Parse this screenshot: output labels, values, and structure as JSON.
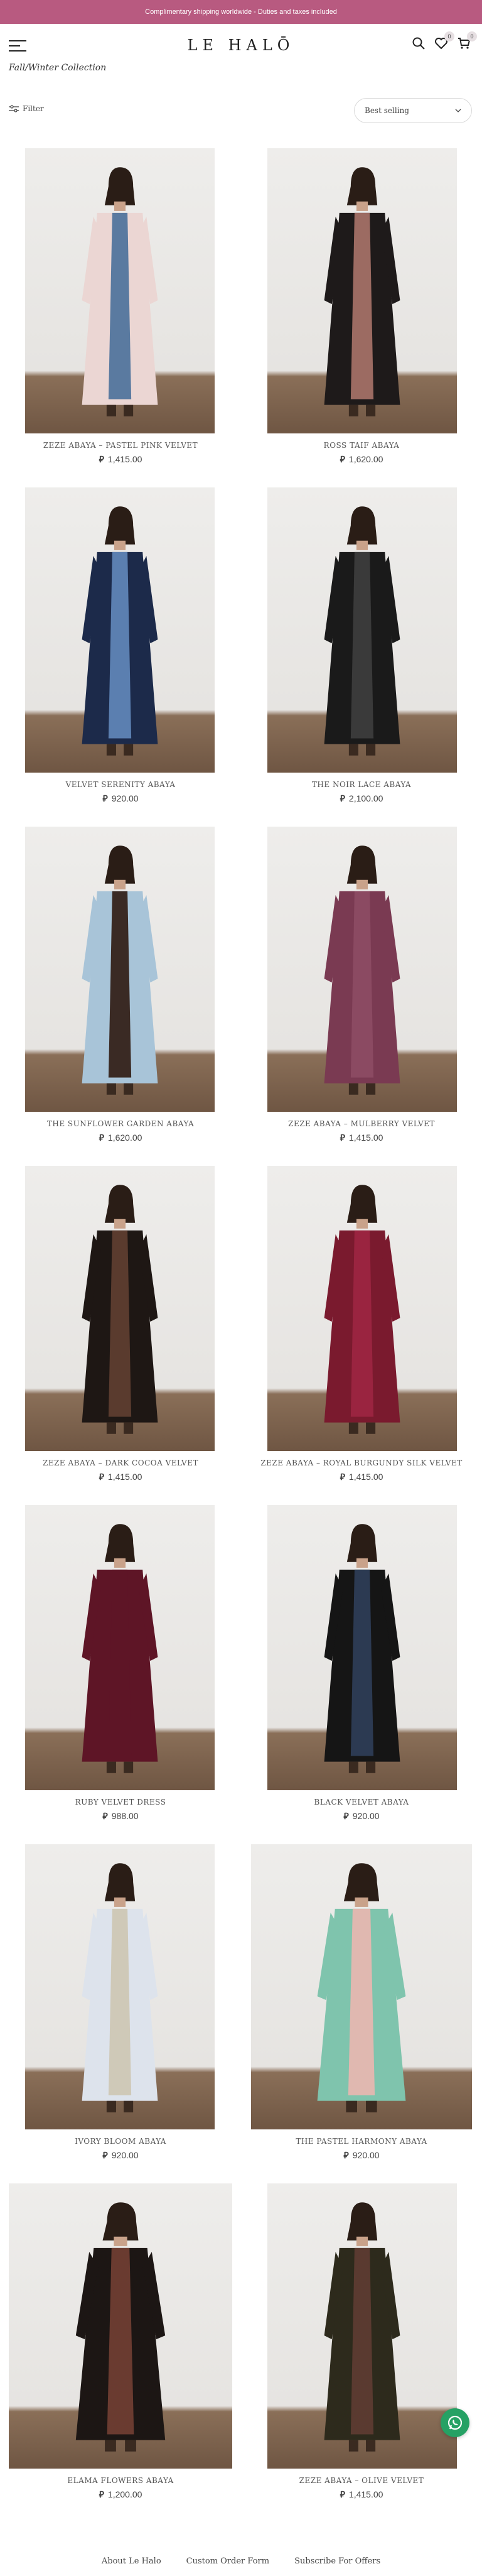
{
  "promo": {
    "text": "Complimentary shipping worldwide - Duties and taxes included"
  },
  "header": {
    "logo": "LE HALŌ",
    "wishlist_count": "0",
    "cart_count": "0"
  },
  "collection": {
    "title": "Fall/Winter Collection"
  },
  "toolbar": {
    "filter_label": "Filter",
    "sort_value": "Best selling"
  },
  "currency_symbol": "⃁",
  "products": [
    {
      "name": "ZEZE ABAYA – PASTEL PINK VELVET",
      "price": "1,415.00",
      "robe": "#ebd6d3",
      "inner": "#5a7aa0"
    },
    {
      "name": "ROSS TAIF ABAYA",
      "price": "1,620.00",
      "robe": "#1e1a1a",
      "inner": "#9c6b62"
    },
    {
      "name": "VELVET SERENITY ABAYA",
      "price": "920.00",
      "robe": "#1c2a4a",
      "inner": "#5b7fb0"
    },
    {
      "name": "THE NOIR LACE ABAYA",
      "price": "2,100.00",
      "robe": "#1a1a1a",
      "inner": "#3a3a3a"
    },
    {
      "name": "THE SUNFLOWER GARDEN ABAYA",
      "price": "1,620.00",
      "robe": "#a8c4d8",
      "inner": "#3a2a24"
    },
    {
      "name": "ZEZE ABAYA – MULBERRY VELVET",
      "price": "1,415.00",
      "robe": "#7a3a52",
      "inner": "#8b4a62"
    },
    {
      "name": "ZEZE ABAYA – DARK COCOA VELVET",
      "price": "1,415.00",
      "robe": "#1e1714",
      "inner": "#5a3b2e"
    },
    {
      "name": "ZEZE ABAYA – ROYAL BURGUNDY SILK VELVET",
      "price": "1,415.00",
      "robe": "#7a1a2e",
      "inner": "#9a2440"
    },
    {
      "name": "RUBY VELVET DRESS",
      "price": "988.00",
      "robe": "#5e1526",
      "inner": "#5e1526"
    },
    {
      "name": "BLACK VELVET ABAYA",
      "price": "920.00",
      "robe": "#151515",
      "inner": "#2c3a52"
    },
    {
      "name": "IVORY BLOOM ABAYA",
      "price": "920.00",
      "robe": "#dde3ec",
      "inner": "#cfc9b8"
    },
    {
      "name": "THE PASTEL HARMONY ABAYA",
      "price": "920.00",
      "robe": "#7fc4ad",
      "inner": "#e0b8b0"
    },
    {
      "name": "ELAMA FLOWERS ABAYA",
      "price": "1,200.00",
      "robe": "#1c1614",
      "inner": "#6a3b30"
    },
    {
      "name": "ZEZE ABAYA – OLIVE VELVET",
      "price": "1,415.00",
      "robe": "#2d2a1c",
      "inner": "#5a3a30"
    }
  ],
  "footer": {
    "links": [
      "About Le Halo",
      "Custom Order Form",
      "Subscribe For Offers"
    ]
  },
  "colors": {
    "promo_bg": "#b85a80",
    "whatsapp": "#25a164"
  }
}
